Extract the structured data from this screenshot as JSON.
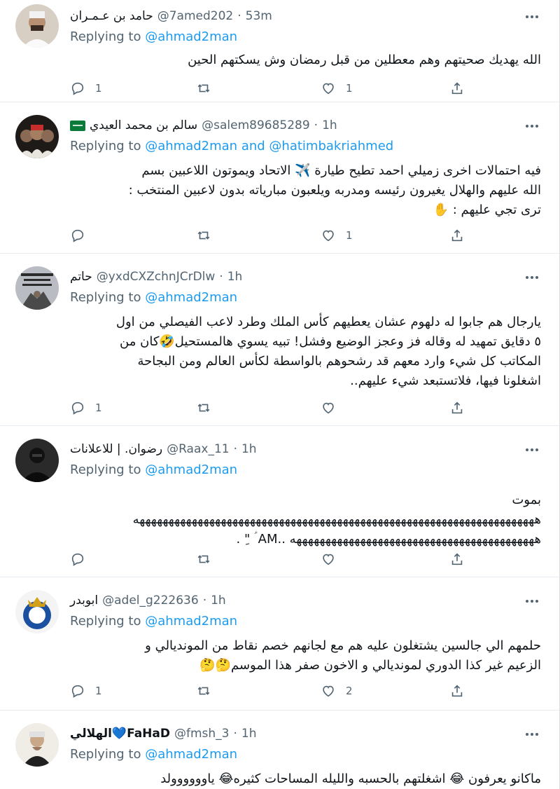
{
  "tweets": [
    {
      "display_name": "حامد بن عـمـران",
      "handle": "@7amed202",
      "time": "53m",
      "replying_label": "Replying to",
      "mention_1": "@ahmad2man",
      "joiner": "",
      "mention_2": "",
      "lines": [
        "الله يهديك صحيتهم وهم معطلين من قبل رمضان وش يسكتهم الحين"
      ],
      "replies": "1",
      "retweets": "",
      "likes": "1"
    },
    {
      "display_name": "سالم بن محمد العيدي",
      "handle": "@salem89685289",
      "time": "1h",
      "replying_label": "Replying to",
      "mention_1": "@ahmad2man",
      "joiner": "and",
      "mention_2": "@hatimbakriahmed",
      "lines": [
        "فيه احتمالات اخرى زميلي احمد  تطيح طيارة ✈️  الاتحاد  ويموتون اللاعبين بسم",
        "الله عليهم والهلال يغيرون رئيسه ومدربه ويلعبون مبارياته بدون لاعبين المنتخب :",
        "ترى تجي عليهم : ✋"
      ],
      "replies": "",
      "retweets": "",
      "likes": "1"
    },
    {
      "display_name": "حاتم",
      "handle": "@yxdCXZchnJCrDlw",
      "time": "1h",
      "replying_label": "Replying to",
      "mention_1": "@ahmad2man",
      "joiner": "",
      "mention_2": "",
      "lines": [
        "يارجال هم جابوا له دلهوم عشان يعطيهم كأس الملك وطرد لاعب الفيصلي من اول",
        "٥ دقايق تمهيد له وقاله فز وعجز الوضيع وفشل! تبيه يسوي هالمستحيل🤣كان من",
        "المكاتب كل شيء وارد معهم قد رشحوهم بالواسطة لكأس العالم ومن البجاحة",
        "اشغلونا فيها، فلاتستبعد شيء عليهم.."
      ],
      "replies": "1",
      "retweets": "",
      "likes": ""
    },
    {
      "display_name": "رضوان. | للاعلانات",
      "handle": "@Raax_11",
      "time": "1h",
      "replying_label": "Replying to",
      "mention_1": "@ahmad2man",
      "joiner": "",
      "mention_2": "",
      "lines": [
        "بموت",
        "هههههههههههههههههههههههههههههههههههههههههههههههههههههههههههههههههههههه",
        "ههههههههههههههههههههههههههههههههههههههههههه ..AM ؑ \"ِ ."
      ],
      "replies": "",
      "retweets": "",
      "likes": ""
    },
    {
      "display_name": "ابوبدر",
      "handle": "@adel_g222636",
      "time": "1h",
      "replying_label": "Replying to",
      "mention_1": "@ahmad2man",
      "joiner": "",
      "mention_2": "",
      "lines": [
        "حلمهم الي جالسين يشتغلون عليه هم مع لجانهم خصم نقاط من المونديالي و",
        "الزعيم غير كذا الدوري لمونديالي و الاخون صفر هذا الموسم🤔🤔"
      ],
      "replies": "1",
      "retweets": "",
      "likes": "2"
    },
    {
      "display_name": "FaHaD💙الهلالي",
      "handle": "@fmsh_3",
      "time": "1h",
      "replying_label": "Replying to",
      "mention_1": "@ahmad2man",
      "joiner": "",
      "mention_2": "",
      "lines": [
        "ماكانو  يعرفون 😂 اشغلتهم بالحسبه والليله المساحات كثيره😂 ياوووووولد"
      ],
      "replies": "",
      "retweets": "",
      "likes": ""
    }
  ],
  "icons": {
    "reply": "reply-icon",
    "retweet": "retweet-icon",
    "like": "like-icon",
    "share": "share-icon",
    "more": "more-icon"
  },
  "colors": {
    "accent": "#1d9bf0",
    "secondary_text": "#536471",
    "text": "#0f1419",
    "divider": "#e6ecf0"
  }
}
